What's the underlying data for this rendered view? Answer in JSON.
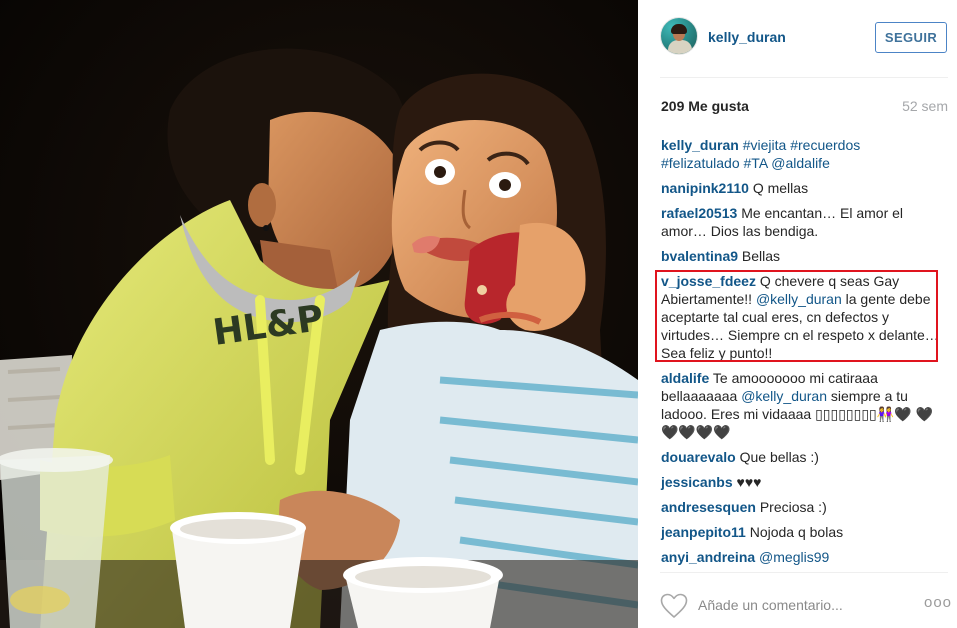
{
  "header": {
    "username": "kelly_duran",
    "follow_label": "SEGUIR"
  },
  "stats": {
    "likes": "209 Me gusta",
    "age": "52 sem"
  },
  "comments": [
    {
      "user": "kelly_duran",
      "parts": [
        {
          "t": "#viejita",
          "tag": true
        },
        {
          "t": " ",
          "tag": false
        },
        {
          "t": "#recuerdos",
          "tag": true
        },
        {
          "t": " ",
          "tag": false
        },
        {
          "t": "#felizatulado",
          "tag": true
        },
        {
          "t": " ",
          "tag": false
        },
        {
          "t": "#TA",
          "tag": true
        },
        {
          "t": " ",
          "tag": false
        },
        {
          "t": "@aldalife",
          "tag": true
        }
      ]
    },
    {
      "user": "nanipink2110",
      "parts": [
        {
          "t": "Q mellas",
          "tag": false
        }
      ]
    },
    {
      "user": "rafael20513",
      "parts": [
        {
          "t": "Me encantan… El amor el amor… Dios las bendiga.",
          "tag": false
        }
      ]
    },
    {
      "user": "bvalentina9",
      "parts": [
        {
          "t": "Bellas",
          "tag": false
        }
      ]
    },
    {
      "user": "v_josse_fdeez",
      "parts": [
        {
          "t": "Q chevere q seas Gay Abiertamente!! ",
          "tag": false
        },
        {
          "t": "@kelly_duran",
          "tag": true
        },
        {
          "t": " la gente debe aceptarte tal cual eres, cn defectos y virtudes… Siempre cn el respeto x delante… Sea feliz y punto!!",
          "tag": false
        }
      ]
    },
    {
      "user": "aldalife",
      "parts": [
        {
          "t": "Te amooooooo mi catiraaa bellaaaaaaa ",
          "tag": false
        },
        {
          "t": "@kelly_duran",
          "tag": true
        },
        {
          "t": " siempre a tu ladooo. Eres mi vidaaaa ▯▯▯▯▯▯▯▯👭🖤 🖤🖤🖤🖤🖤",
          "tag": false
        }
      ]
    },
    {
      "user": "douarevalo",
      "parts": [
        {
          "t": "Que bellas :)",
          "tag": false
        }
      ]
    },
    {
      "user": "jessicanbs",
      "parts": [
        {
          "t": "♥♥♥",
          "tag": false
        }
      ]
    },
    {
      "user": "andresesquen",
      "parts": [
        {
          "t": "Preciosa :)",
          "tag": false
        }
      ]
    },
    {
      "user": "jeanpepito11",
      "parts": [
        {
          "t": "Nojoda q bolas",
          "tag": false
        }
      ]
    },
    {
      "user": "anyi_andreina",
      "parts": [
        {
          "t": "@meglis99",
          "tag": true
        }
      ]
    }
  ],
  "footer": {
    "comment_placeholder": "Añade un comentario...",
    "more_label": "ooo"
  },
  "icons": {
    "like": "heart-outline-icon",
    "more": "more-options-icon"
  },
  "colors": {
    "link": "#125688",
    "follow_border": "#4c84c6",
    "highlight": "#e0141e",
    "muted": "#a5a7aa"
  }
}
